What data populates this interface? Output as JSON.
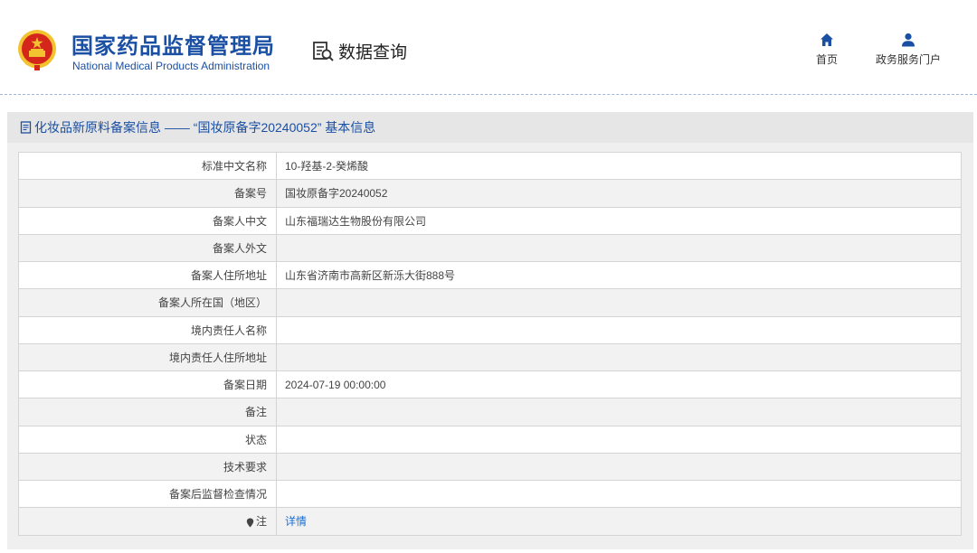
{
  "header": {
    "site_name_cn": "国家药品监督管理局",
    "site_name_en": "National Medical Products Administration",
    "section_title": "数据查询",
    "nav": [
      {
        "label": "首页",
        "icon": "home-icon"
      },
      {
        "label": "政务服务门户",
        "icon": "user-icon"
      }
    ]
  },
  "panel": {
    "title": "化妆品新原料备案信息 —— “国妆原备字20240052” 基本信息"
  },
  "rows": [
    {
      "label": "标准中文名称",
      "value": "10-羟基-2-癸烯酸"
    },
    {
      "label": "备案号",
      "value": "国妆原备字20240052"
    },
    {
      "label": "备案人中文",
      "value": "山东福瑞达生物股份有限公司"
    },
    {
      "label": "备案人外文",
      "value": ""
    },
    {
      "label": "备案人住所地址",
      "value": "山东省济南市高新区新泺大街888号"
    },
    {
      "label": "备案人所在国（地区）",
      "value": ""
    },
    {
      "label": "境内责任人名称",
      "value": ""
    },
    {
      "label": "境内责任人住所地址",
      "value": ""
    },
    {
      "label": "备案日期",
      "value": "2024-07-19 00:00:00"
    },
    {
      "label": "备注",
      "value": ""
    },
    {
      "label": "状态",
      "value": ""
    },
    {
      "label": "技术要求",
      "value": ""
    },
    {
      "label": "备案后监督检查情况",
      "value": ""
    },
    {
      "label": "注",
      "value": "详情",
      "icon": "pin-icon"
    }
  ],
  "colors": {
    "brand_blue": "#1a4fa3",
    "link_blue": "#1a6fd6",
    "emblem_red": "#d5261c",
    "emblem_gold": "#f2c230"
  }
}
